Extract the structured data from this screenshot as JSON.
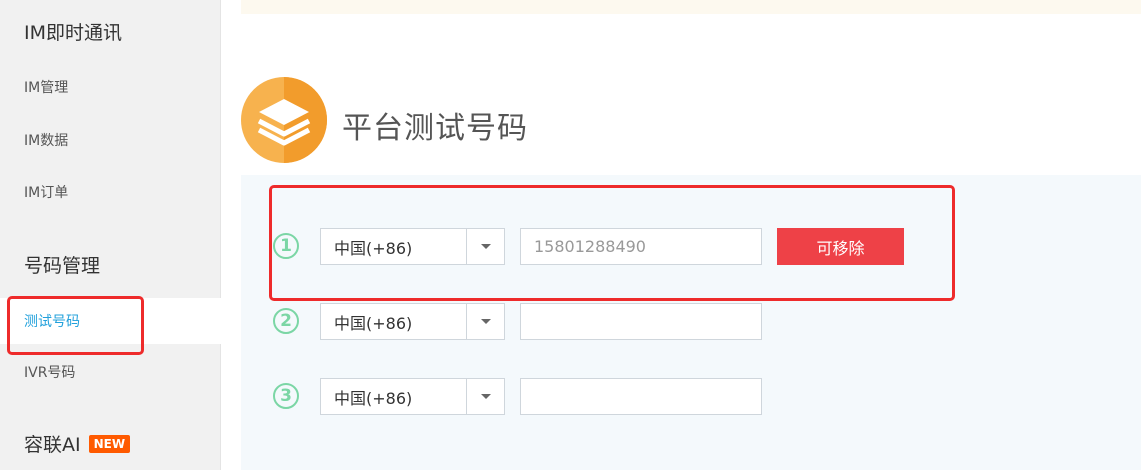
{
  "sidebar": {
    "groups": [
      {
        "label": "IM即时通讯"
      },
      {
        "label": "号码管理"
      },
      {
        "label": "容联AI",
        "badge": "NEW"
      }
    ],
    "items": [
      {
        "label": "IM管理"
      },
      {
        "label": "IM数据"
      },
      {
        "label": "IM订单"
      },
      {
        "label": "测试号码"
      },
      {
        "label": "IVR号码"
      }
    ]
  },
  "main": {
    "title": "平台测试号码",
    "rows": [
      {
        "index": "1",
        "country": "中国(+86)",
        "phone": "15801288490",
        "action": "可移除"
      },
      {
        "index": "2",
        "country": "中国(+86)",
        "phone": ""
      },
      {
        "index": "3",
        "country": "中国(+86)",
        "phone": ""
      }
    ]
  },
  "colors": {
    "accent": "#21a0db",
    "remove": "#ee4147",
    "badge": "#ff5a00",
    "circle": "#7bd6a5"
  }
}
